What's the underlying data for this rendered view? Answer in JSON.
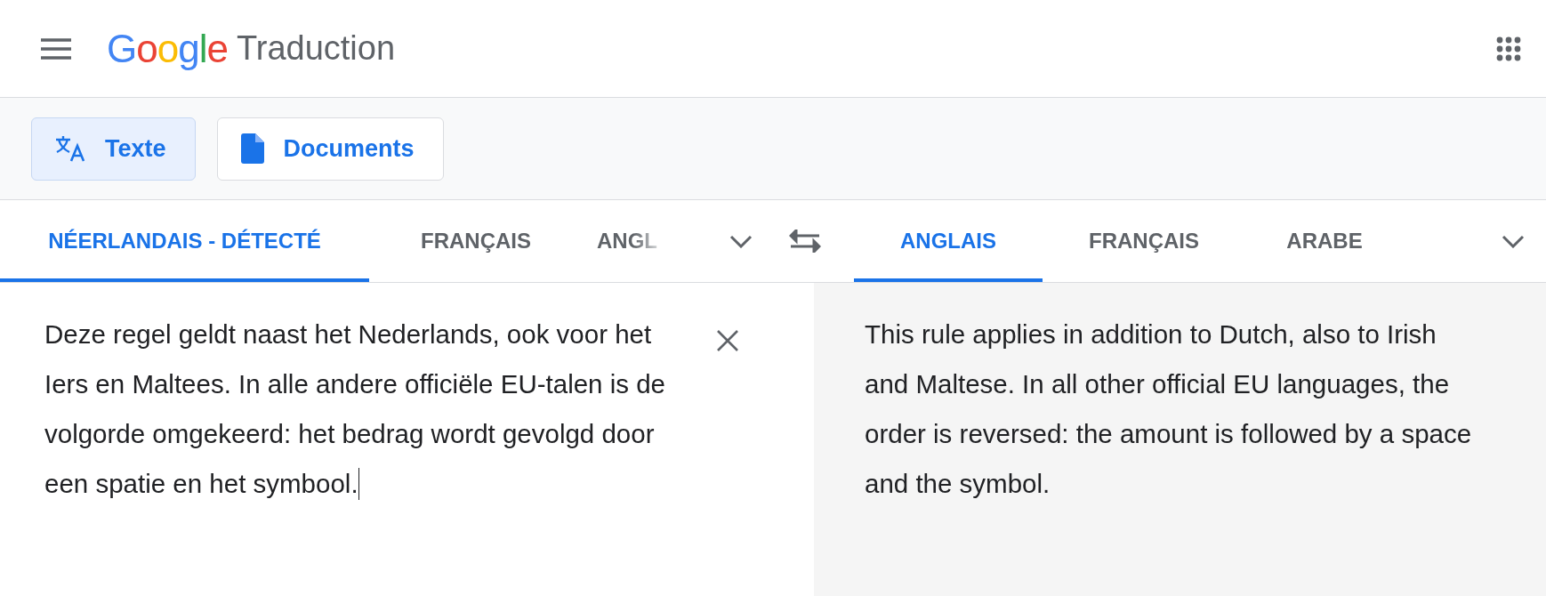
{
  "header": {
    "logo": "Google",
    "product": "Traduction"
  },
  "modes": [
    {
      "label": "Texte",
      "kind": "text",
      "selected": true
    },
    {
      "label": "Documents",
      "kind": "document",
      "selected": false
    }
  ],
  "source_languages": [
    {
      "label": "NÉERLANDAIS - DÉTECTÉ",
      "selected": true
    },
    {
      "label": "FRANÇAIS",
      "selected": false
    },
    {
      "label": "ANGL",
      "selected": false
    }
  ],
  "target_languages": [
    {
      "label": "ANGLAIS",
      "selected": true
    },
    {
      "label": "FRANÇAIS",
      "selected": false
    },
    {
      "label": "ARABE",
      "selected": false
    }
  ],
  "source_text": "Deze regel geldt naast het Nederlands, ook voor het Iers en Maltees. In alle andere officiële EU-talen is de volgorde omgekeerd: het bedrag wordt gevolgd door een spatie en het symbool.",
  "translation": "This rule applies in addition to Dutch, also to Irish and Maltese. In all other official EU languages, the order is reversed: the amount is followed by a space and the symbol."
}
